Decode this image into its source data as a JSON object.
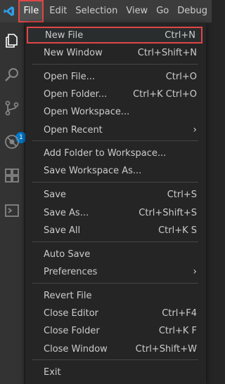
{
  "menubar": {
    "items": [
      "File",
      "Edit",
      "Selection",
      "View",
      "Go",
      "Debug"
    ]
  },
  "activity_bar": {
    "icons": [
      "explorer-icon",
      "search-icon",
      "source-control-icon",
      "debug-icon",
      "extensions-icon",
      "terminal-icon"
    ],
    "source_control_badge": "1"
  },
  "file_menu": {
    "items": [
      {
        "label": "New File",
        "shortcut": "Ctrl+N"
      },
      {
        "label": "New Window",
        "shortcut": "Ctrl+Shift+N"
      },
      {
        "label": "Open File...",
        "shortcut": "Ctrl+O"
      },
      {
        "label": "Open Folder...",
        "shortcut": "Ctrl+K Ctrl+O"
      },
      {
        "label": "Open Workspace...",
        "shortcut": ""
      },
      {
        "label": "Open Recent",
        "shortcut": ""
      },
      {
        "label": "Add Folder to Workspace...",
        "shortcut": ""
      },
      {
        "label": "Save Workspace As...",
        "shortcut": ""
      },
      {
        "label": "Save",
        "shortcut": "Ctrl+S"
      },
      {
        "label": "Save As...",
        "shortcut": "Ctrl+Shift+S"
      },
      {
        "label": "Save All",
        "shortcut": "Ctrl+K S"
      },
      {
        "label": "Auto Save",
        "shortcut": ""
      },
      {
        "label": "Preferences",
        "shortcut": ""
      },
      {
        "label": "Revert File",
        "shortcut": ""
      },
      {
        "label": "Close Editor",
        "shortcut": "Ctrl+F4"
      },
      {
        "label": "Close Folder",
        "shortcut": "Ctrl+K F"
      },
      {
        "label": "Close Window",
        "shortcut": "Ctrl+Shift+W"
      },
      {
        "label": "Exit",
        "shortcut": ""
      }
    ]
  },
  "colors": {
    "menubar_bg": "#3c3c3c",
    "menu_bg": "#252526",
    "activity_bar_bg": "#333333",
    "highlight_border": "#e04646",
    "badge_bg": "#007acc"
  }
}
